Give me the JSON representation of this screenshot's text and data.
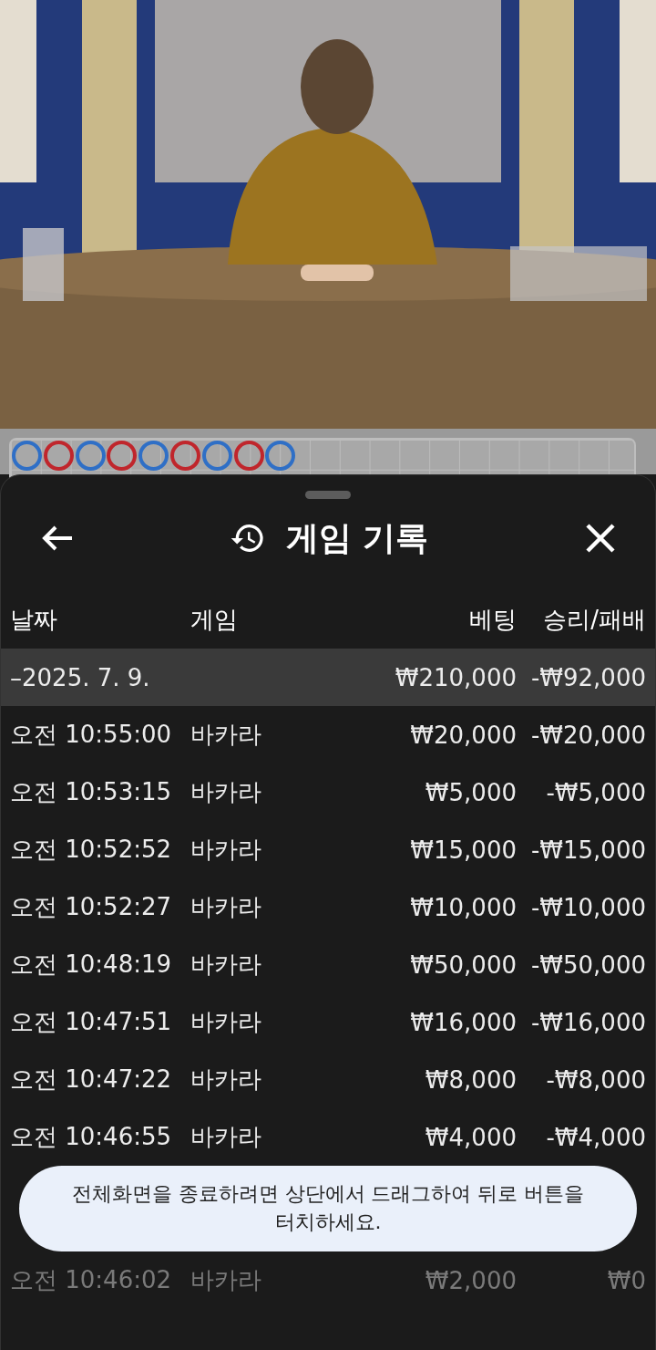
{
  "roadmap": {
    "beads": [
      {
        "color": "#2f6fc6"
      },
      {
        "color": "#c0262c"
      },
      {
        "color": "#2f6fc6"
      },
      {
        "color": "#c0262c"
      },
      {
        "color": "#2f6fc6"
      },
      {
        "color": "#c0262c"
      },
      {
        "color": "#2f6fc6"
      },
      {
        "color": "#c0262c"
      },
      {
        "color": "#2f6fc6"
      }
    ]
  },
  "sheet": {
    "title": "게임 기록",
    "table": {
      "columns": [
        "날짜",
        "게임",
        "베팅",
        "승리/패배"
      ],
      "summary": {
        "date": "–2025. 7. 9.",
        "bet": "₩210,000",
        "result": "-₩92,000"
      },
      "rows": [
        {
          "time": "오전 10:55:00",
          "game": "바카라",
          "bet": "₩20,000",
          "result": "-₩20,000",
          "faded": false
        },
        {
          "time": "오전 10:53:15",
          "game": "바카라",
          "bet": "₩5,000",
          "result": "-₩5,000",
          "faded": false
        },
        {
          "time": "오전 10:52:52",
          "game": "바카라",
          "bet": "₩15,000",
          "result": "-₩15,000",
          "faded": false
        },
        {
          "time": "오전 10:52:27",
          "game": "바카라",
          "bet": "₩10,000",
          "result": "-₩10,000",
          "faded": false
        },
        {
          "time": "오전 10:48:19",
          "game": "바카라",
          "bet": "₩50,000",
          "result": "-₩50,000",
          "faded": false
        },
        {
          "time": "오전 10:47:51",
          "game": "바카라",
          "bet": "₩16,000",
          "result": "-₩16,000",
          "faded": false
        },
        {
          "time": "오전 10:47:22",
          "game": "바카라",
          "bet": "₩8,000",
          "result": "-₩8,000",
          "faded": false
        },
        {
          "time": "오전 10:46:55",
          "game": "바카라",
          "bet": "₩4,000",
          "result": "-₩4,000",
          "faded": false
        },
        {
          "time": "오전 10:46:02",
          "game": "바카라",
          "bet": "₩2,000",
          "result": "₩0",
          "faded": true
        }
      ]
    }
  },
  "toast": {
    "text": "전체화면을 종료하려면 상단에서 드래그하여 뒤로 버튼을 터치하세요."
  }
}
